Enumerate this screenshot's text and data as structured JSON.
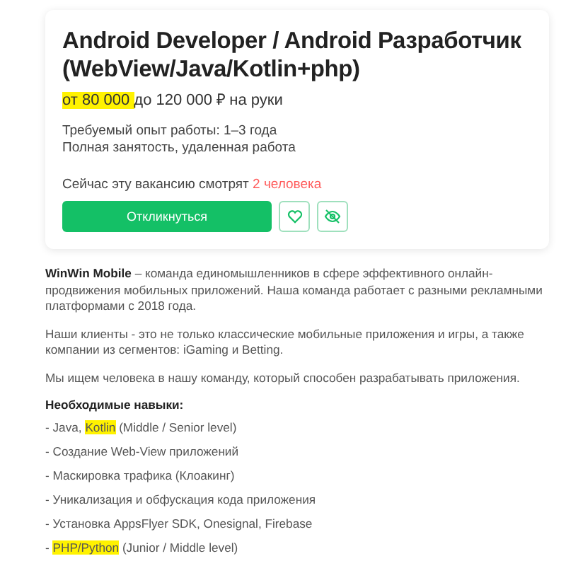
{
  "vacancy": {
    "title": "Android Developer / Android Разработчик (WebView/Java/Kotlin+php)",
    "salary": [
      {
        "text": "от 80 000 ",
        "highlighted": true
      },
      {
        "text": "до 120 000 ₽ на руки",
        "highlighted": false
      }
    ],
    "experience": "Требуемый опыт работы: 1–3 года",
    "employment": "Полная занятость, удаленная работа",
    "viewers_text": "Сейчас эту вакансию смотрят",
    "viewers_count": "2 человека",
    "apply_button": "Откликнуться"
  },
  "description": {
    "paragraphs": [
      "**WinWin Mobile** – команда единомышленников в сфере эффективного онлайн-продвижения мобильных приложений. Наша команда работает с разными рекламными платформами с 2018 года.",
      "Наши клиенты - это не только классические мобильные приложения и игры, а также компании из сегментов: iGaming и Betting.",
      "Мы ищем человека в нашу команду, который способен разрабатывать приложения."
    ],
    "skills_heading": "Необходимые навыки:",
    "skills": [
      [
        {
          "text": "- Java, ",
          "highlighted": false
        },
        {
          "text": "Kotlin",
          "highlighted": true
        },
        {
          "text": " (Middle / Senior level)",
          "highlighted": false
        }
      ],
      [
        {
          "text": "- Создание Web-View приложений",
          "highlighted": false
        }
      ],
      [
        {
          "text": "- Маскировка трафика (Клоакинг)",
          "highlighted": false
        }
      ],
      [
        {
          "text": "- Уникализация и обфускация кода приложения",
          "highlighted": false
        }
      ],
      [
        {
          "text": "- Установка AppsFlyer SDK, Onesignal, Firebase",
          "highlighted": false
        }
      ],
      [
        {
          "text": "- ",
          "highlighted": false
        },
        {
          "text": "PHP/Python",
          "highlighted": true
        },
        {
          "text": " (Junior / Middle level)",
          "highlighted": false
        }
      ]
    ]
  }
}
